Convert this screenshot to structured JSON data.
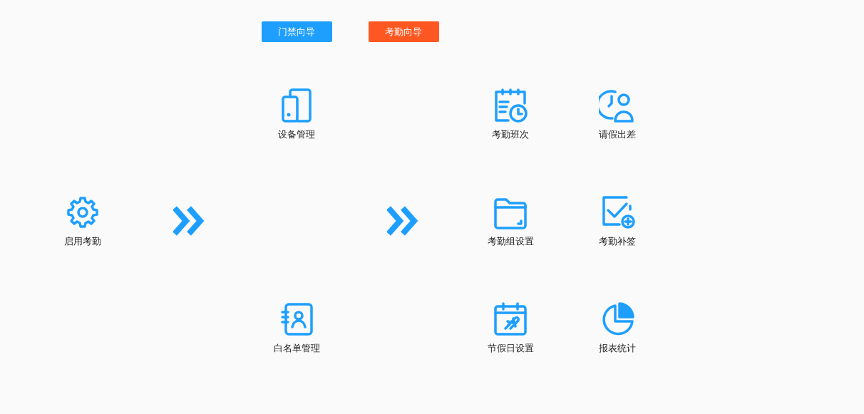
{
  "buttons": [
    {
      "label": "门禁向导",
      "color": "#1e9fff"
    },
    {
      "label": "考勤向导",
      "color": "#ff5722"
    }
  ],
  "columns": [
    {
      "kind": "tiles",
      "tiles": [
        {
          "label": "启用考勤"
        }
      ]
    },
    {
      "kind": "arrow"
    },
    {
      "kind": "tiles",
      "tiles": [
        {
          "label": "设备管理"
        },
        {
          "label": "白名单管理"
        }
      ]
    },
    {
      "kind": "arrow"
    },
    {
      "kind": "tiles",
      "tiles": [
        {
          "label": "考勤班次"
        },
        {
          "label": "考勤组设置"
        },
        {
          "label": "节假日设置"
        }
      ]
    },
    {
      "kind": "tiles",
      "tiles": [
        {
          "label": "请假出差"
        },
        {
          "label": "考勤补签"
        },
        {
          "label": "报表统计"
        }
      ]
    }
  ]
}
